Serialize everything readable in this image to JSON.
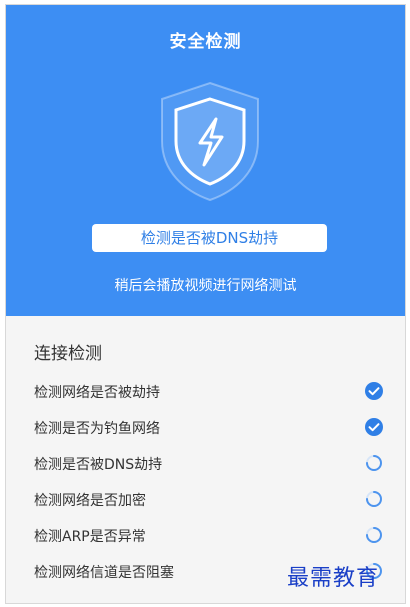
{
  "header": {
    "title": "安全检测",
    "status": "检测是否被DNS劫持",
    "hint": "稍后会播放视频进行网络测试",
    "shield_icon": "shield-lightning-icon"
  },
  "connection": {
    "section_title": "连接检测",
    "items": [
      {
        "label": "检测网络是否被劫持",
        "state": "done",
        "icon": "checkmark-circle-icon"
      },
      {
        "label": "检测是否为钓鱼网络",
        "state": "done",
        "icon": "checkmark-circle-icon"
      },
      {
        "label": "检测是否被DNS劫持",
        "state": "loading",
        "icon": "loading-spinner-icon"
      },
      {
        "label": "检测网络是否加密",
        "state": "loading",
        "icon": "loading-spinner-icon"
      },
      {
        "label": "检测ARP是否异常",
        "state": "loading",
        "icon": "loading-spinner-icon"
      },
      {
        "label": "检测网络信道是否阻塞",
        "state": "loading",
        "icon": "loading-spinner-icon"
      }
    ]
  },
  "watermark": "最需教育",
  "colors": {
    "primary": "#3d8ef3",
    "check": "#2f7fe6",
    "text": "#333333",
    "background": "#f5f5f5"
  }
}
